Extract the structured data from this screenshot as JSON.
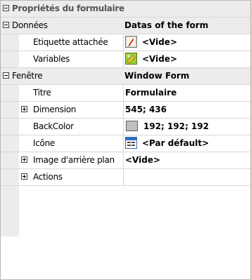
{
  "panel": {
    "title": "Propriétés du formulaire",
    "rows": [
      {
        "name": "Données",
        "value": "Datas of the form"
      },
      {
        "name": "Etiquette attachée",
        "value": "<Vide>",
        "icon": "label-icon"
      },
      {
        "name": "Variables",
        "value": "<Vide>",
        "icon": "variables-icon"
      },
      {
        "name": "Fenêtre",
        "value": "Window Form"
      },
      {
        "name": "Titre",
        "value": "Formulaire"
      },
      {
        "name": "Dimension",
        "value": "545; 436"
      },
      {
        "name": "BackColor",
        "value": "192; 192; 192",
        "color": "#c0c0c0"
      },
      {
        "name": "Icône",
        "value": "<Par défault>",
        "icon": "form-icon"
      },
      {
        "name": "Image d'arrière plan",
        "value": "<Vide>"
      },
      {
        "name": "Actions",
        "value": ""
      }
    ]
  }
}
